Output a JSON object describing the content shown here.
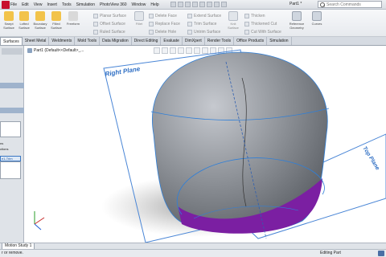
{
  "menu": [
    "File",
    "Edit",
    "View",
    "Insert",
    "Tools",
    "Simulation",
    "PhotoView 360",
    "Window",
    "Help"
  ],
  "document_title": "Part1 *",
  "search": {
    "placeholder": "Search Commands"
  },
  "ribbon": {
    "big_buttons": [
      {
        "label": "Swept Surface",
        "color": "#f2c34a"
      },
      {
        "label": "Lofted Surface",
        "color": "#f2c34a"
      },
      {
        "label": "Boundary Surface",
        "color": "#f2c34a"
      },
      {
        "label": "Filled Surface",
        "color": "#f2c34a"
      },
      {
        "label": "Freeform",
        "color": "#d9d9d9"
      }
    ],
    "col1": [
      "Planar Surface",
      "Offset Surface",
      "Ruled Surface"
    ],
    "fillet": "Fillet",
    "col2": [
      "Delete Face",
      "Replace Face",
      "Delete Hole"
    ],
    "col3": [
      "Extend Surface",
      "Trim Surface",
      "Untrim Surface"
    ],
    "knit": "Knit Surface",
    "col4": [
      "Thicken",
      "Thickened Cut",
      "Cut With Surface"
    ],
    "reference_geometry": "Reference Geometry",
    "curves": "Curves"
  },
  "tabs": [
    "Surfaces",
    "Sheet Metal",
    "Weldments",
    "Mold Tools",
    "Data Migration",
    "Direct Editing",
    "Evaluate",
    "DimXpert",
    "Render Tools",
    "Office Products",
    "Simulation"
  ],
  "active_tab": "Surfaces",
  "left_panel": {
    "text1": "ns",
    "text2": "ctions",
    "selection": "e1-Trim"
  },
  "tree_label": "Part1 (Default<<Default>_...",
  "planes": {
    "right": "Right Plane",
    "top": "Top Plane"
  },
  "motion_tab": "Motion Study 1",
  "status": {
    "left": "r or remove.",
    "right": "Editing Part"
  },
  "colors": {
    "body": "#8d9197",
    "bottom_face": "#7b1fa2",
    "edges": "#2f7fd8",
    "plane_label": "#2f6fc4"
  }
}
